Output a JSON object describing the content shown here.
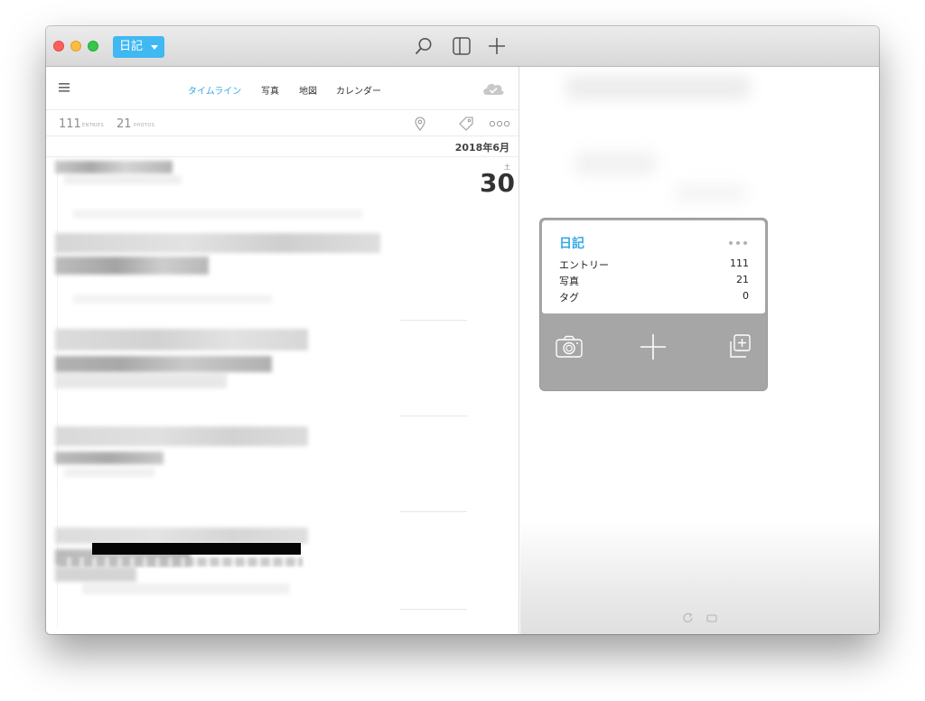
{
  "titlebar": {
    "journal_name": "日記",
    "icons": [
      "search-icon",
      "sidebar-icon",
      "plus-icon"
    ]
  },
  "nav": {
    "tabs": [
      {
        "label": "タイムライン",
        "active": true
      },
      {
        "label": "写真",
        "active": false
      },
      {
        "label": "地図",
        "active": false
      },
      {
        "label": "カレンダー",
        "active": false
      }
    ],
    "accent_color": "#35a9e6"
  },
  "stats": {
    "entries_count": "111",
    "entries_label": "ENTRIES",
    "photos_count": "21",
    "photos_label": "PHOTOS"
  },
  "timeline": {
    "month": "2018年6月",
    "day_weekday": "土",
    "day_number": "30"
  },
  "widget": {
    "title": "日記",
    "rows": [
      {
        "label": "エントリー",
        "value": "111"
      },
      {
        "label": "写真",
        "value": "21"
      },
      {
        "label": "タグ",
        "value": "0"
      }
    ],
    "actions": [
      "camera-icon",
      "plus-icon",
      "duplicate-icon"
    ]
  }
}
